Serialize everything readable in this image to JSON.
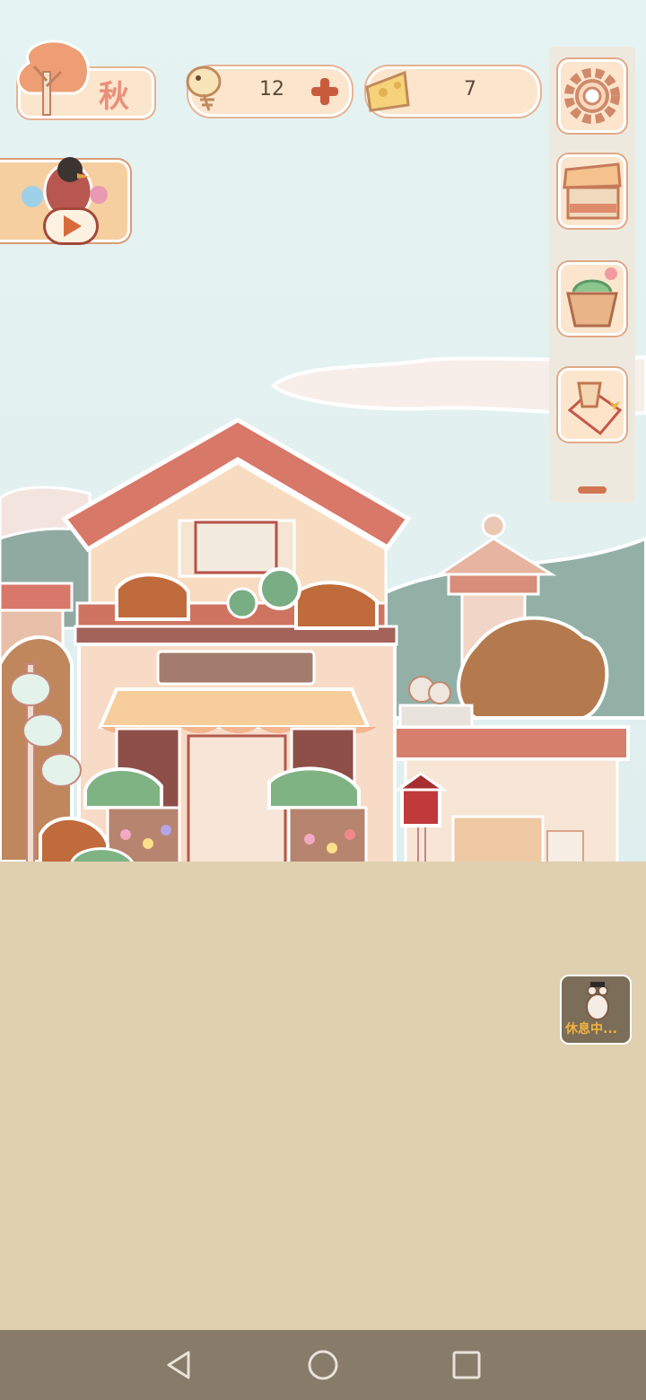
{
  "season": {
    "label": "秋"
  },
  "currencies": {
    "fish": {
      "value": "12"
    },
    "cheese": {
      "value": "7"
    }
  },
  "side_menu": {
    "items": [
      {
        "icon": "gear-icon"
      },
      {
        "icon": "market-stall-icon"
      },
      {
        "icon": "basket-icon"
      },
      {
        "icon": "award-trophy-icon"
      }
    ]
  },
  "resting_badge": {
    "label": "休息中..."
  },
  "nav": {
    "back": "back-icon",
    "home": "home-icon",
    "recents": "recents-icon"
  },
  "colors": {
    "accent": "#e7b292",
    "red_plus": "#c95b3d",
    "navbar": "#877b69",
    "ground": "#dfd0b0"
  }
}
